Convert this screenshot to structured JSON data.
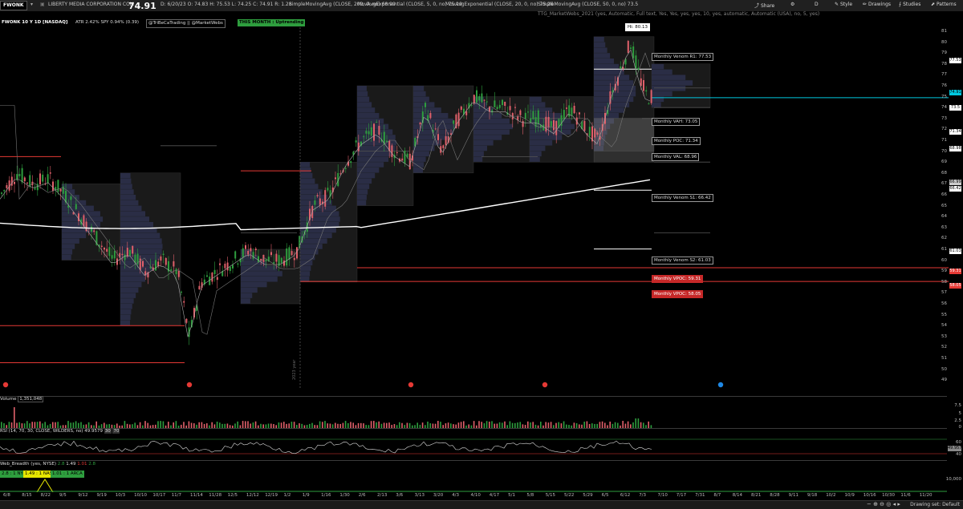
{
  "toolbar": {
    "symbol": "FWONK",
    "company": "LIBERTY MEDIA CORPORATION COM",
    "price": "74.91",
    "ohlc": "D: 6/20/23  O: 74.83  H: 75.53  L: 74.25  C: 74.91  R: 1.28",
    "study_sma200": "SimpleMovingAvg (CLOSE, 200, 0, no)",
    "study_sma200_val": "68.99",
    "study_ema5": "MovAvgExponential (CLOSE, 5, 0, no)",
    "study_ema5_val": "75.19",
    "study_ema20": "MovAvgExponential (CLOSE, 20, 0, no)",
    "study_ema20_val": "75.26",
    "study_sma50": "SimpleMovingAvg (CLOSE, 50, 0, no)",
    "study_sma50_val": "73.5",
    "study_ttg": "TTG_MarketWebs_2021 (yes, Automatic, Full text, Yes, Yes, yes, yes, 10, yes, automatic, Automatic (USA), no, 5, yes)",
    "share_label": "Share",
    "style_label": "Style",
    "drawings_label": "Drawings",
    "studies_label": "Studies",
    "patterns_label": "Patterns",
    "d_label": "D"
  },
  "studybar": {
    "title": "FWONK 10 Y 1D [NASDAQ]",
    "atr": "ATR 2.42% SPY 0.94% (0.39)",
    "tag_handle": "@TriBeCaTrading || @MarketWebs",
    "tag_month": "THIS MONTH : Uptrending"
  },
  "colors": {
    "up": "#2e9e3e",
    "down": "#e0606a",
    "ema_line": "#ffffff",
    "cyan_line": "#00c8e0",
    "red_line": "#e53935"
  },
  "callouts": {
    "high": "Hi: 80.13",
    "r1": "Monthly Venom R1: 77.53",
    "vah": "Monthly VAH: 73.05",
    "poc": "Monthly POC: 71.34",
    "val": "Monthly VAL: 68.96",
    "s1": "Monthly Venom S1: 66.42",
    "s2": "Monthly Venom S2: 61.03",
    "vpoc1": "Monthly VPOC: 59.31",
    "vpoc2": "Monthly VPOC: 58.05"
  },
  "price_axis": [
    "81",
    "80",
    "79",
    "78",
    "77",
    "76",
    "75",
    "74",
    "73",
    "72",
    "71",
    "70",
    "69",
    "68",
    "67",
    "66",
    "65",
    "64",
    "63",
    "62",
    "61",
    "60",
    "59",
    "58",
    "57",
    "56",
    "55",
    "54",
    "53",
    "52",
    "51",
    "50",
    "49"
  ],
  "price_boxes": {
    "b1": "77.53",
    "cur": "74.91",
    "b2": "73.5",
    "b3": "71.34",
    "b4": "68.98",
    "b5": "66.99",
    "b6": "66.42",
    "b7": "61.03",
    "b8": "59.31",
    "b9": "58.05"
  },
  "volume_pane": {
    "label": "Volume",
    "value": "1,351,048",
    "ticks": [
      "7.5",
      "5",
      "2.5",
      "0"
    ]
  },
  "rsi_pane": {
    "label": "RSI (14, 70, 30, CLOSE, WILDERS, no)",
    "value": "49.9579",
    "ob": "30",
    "os": "70",
    "ticks": [
      "60",
      "40"
    ],
    "val_box": "49.9579"
  },
  "breadth_pane": {
    "label": "Web_Breadth (yes, NYSE)",
    "v1": "2.8",
    "v2": "1.49",
    "v3": "1.01",
    "v4": "2.8",
    "tag_nyse": "2.8 : 1 NYSE",
    "tag_nasd": "1.49 : 1 NASD",
    "tag_arca": "1.01 : 1 ARCA",
    "tick": "10,000"
  },
  "year_marker": "2023 year",
  "x_axis": [
    "6/8",
    "8/15",
    "8/22",
    "9/5",
    "9/12",
    "9/19",
    "10/3",
    "10/10",
    "10/17",
    "11/7",
    "11/14",
    "11/28",
    "12/5",
    "12/12",
    "12/19",
    "1/2",
    "1/9",
    "1/16",
    "1/30",
    "2/6",
    "2/13",
    "3/6",
    "3/13",
    "3/20",
    "4/3",
    "4/10",
    "4/17",
    "5/1",
    "5/8",
    "5/15",
    "5/22",
    "5/29",
    "6/5",
    "6/12",
    "7/3",
    "7/10",
    "7/17",
    "7/31",
    "8/7",
    "8/14",
    "8/21",
    "8/28",
    "9/11",
    "9/18",
    "10/2",
    "10/9",
    "10/16",
    "10/30",
    "11/6",
    "11/20"
  ],
  "status": "Drawing set: Default"
}
